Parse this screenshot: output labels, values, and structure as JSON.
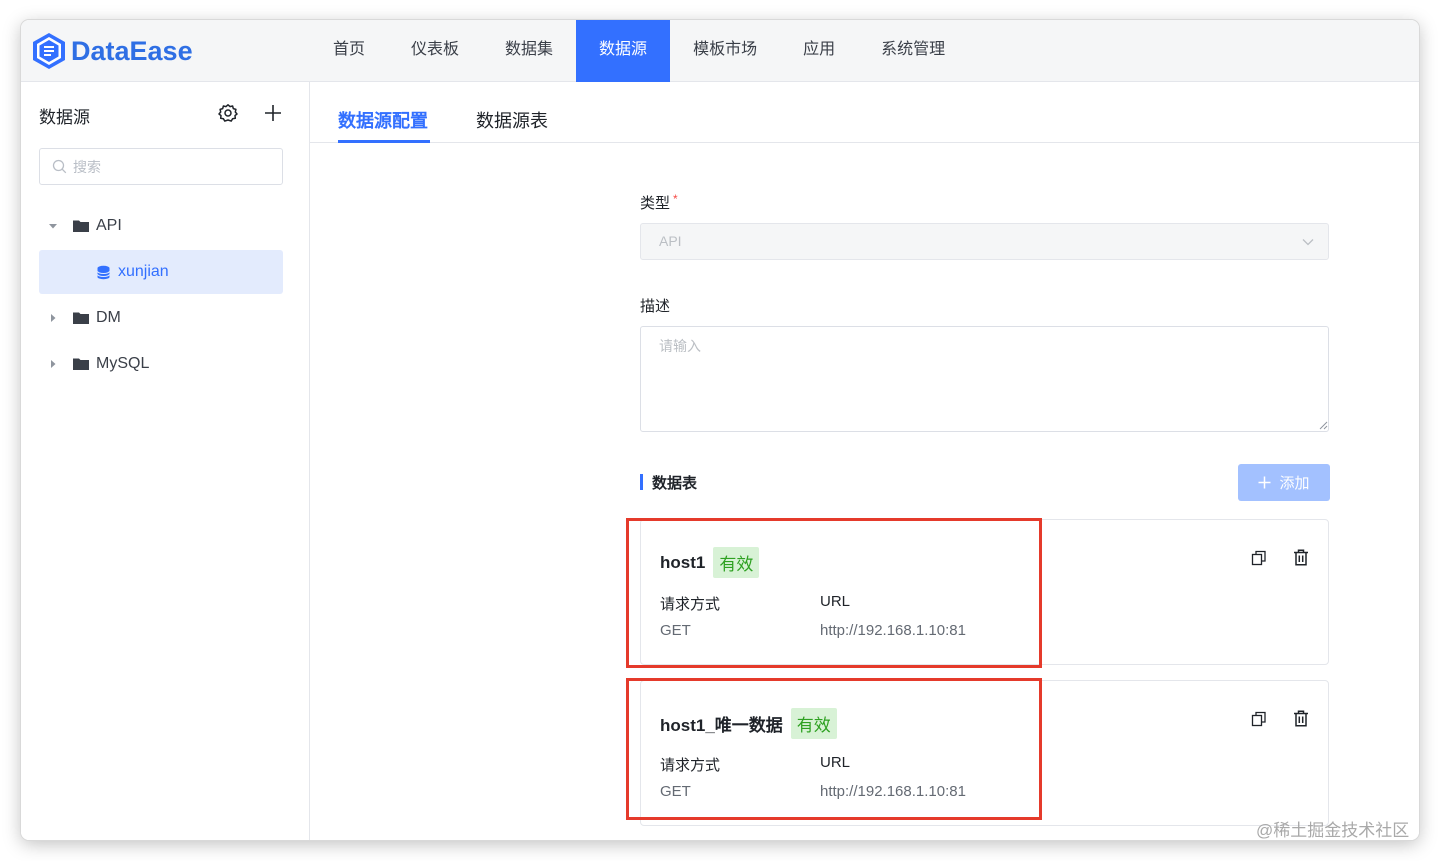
{
  "app": {
    "logo_text": "DataEase",
    "brand_color": "#3370ff"
  },
  "nav": {
    "items": [
      {
        "label": "首页"
      },
      {
        "label": "仪表板"
      },
      {
        "label": "数据集"
      },
      {
        "label": "数据源",
        "active": true
      },
      {
        "label": "模板市场"
      },
      {
        "label": "应用"
      },
      {
        "label": "系统管理"
      }
    ]
  },
  "sidebar": {
    "title": "数据源",
    "gear_icon": "gear-icon",
    "add_icon": "plus-icon",
    "search_placeholder": "搜索",
    "tree": [
      {
        "label": "API",
        "expanded": true,
        "type": "folder"
      },
      {
        "label": "xunjian",
        "type": "datasource",
        "selected": true
      },
      {
        "label": "DM",
        "expanded": false,
        "type": "folder"
      },
      {
        "label": "MySQL",
        "expanded": false,
        "type": "folder"
      }
    ]
  },
  "tabs": [
    {
      "label": "数据源配置",
      "active": true
    },
    {
      "label": "数据源表"
    }
  ],
  "form": {
    "type_label": "类型",
    "type_required": "*",
    "type_value": "API",
    "desc_label": "描述",
    "desc_placeholder": "请输入",
    "section_title": "数据表",
    "add_button": "添加",
    "cards": [
      {
        "name": "host1",
        "status": "有效",
        "method_label": "请求方式",
        "method_value": "GET",
        "url_label": "URL",
        "url_value": "http://192.168.1.10:81"
      },
      {
        "name": "host1_唯一数据",
        "status": "有效",
        "method_label": "请求方式",
        "method_value": "GET",
        "url_label": "URL",
        "url_value": "http://192.168.1.10:81"
      }
    ]
  },
  "watermark": "@稀土掘金技术社区"
}
